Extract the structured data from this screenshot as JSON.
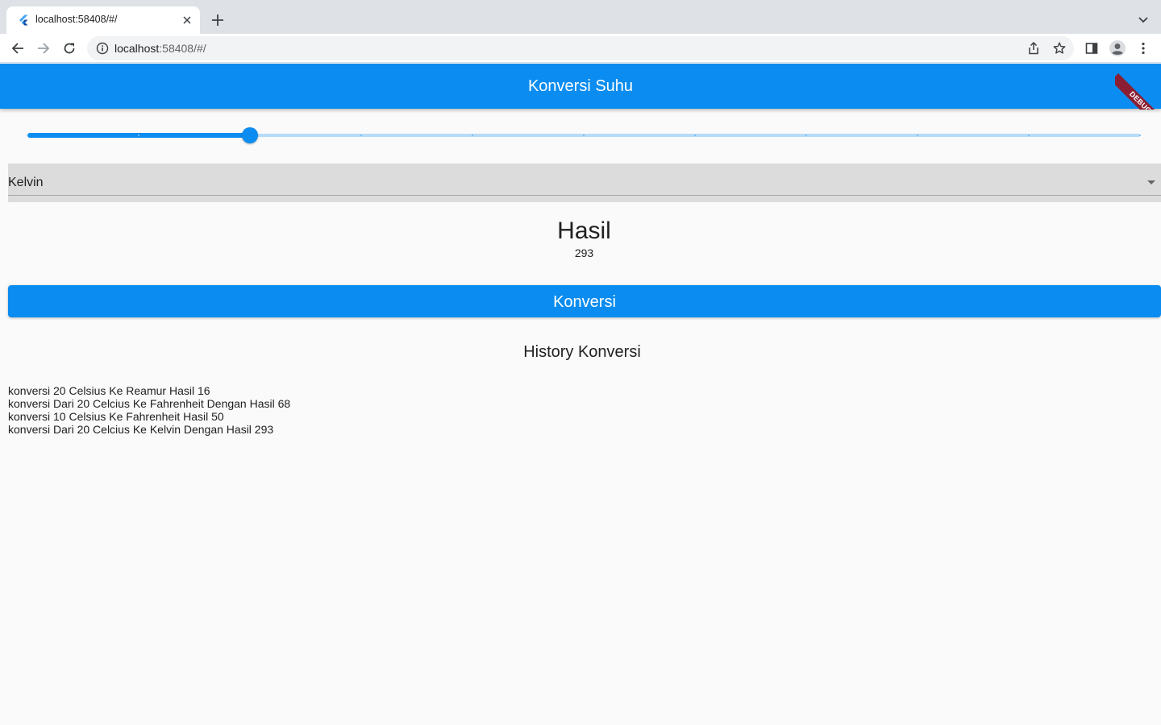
{
  "browser": {
    "tab_title": "localhost:58408/#/",
    "url_host": "localhost",
    "url_path": ":58408/#/"
  },
  "app": {
    "title": "Konversi Suhu",
    "debug_label": "DEBUG",
    "accent_color": "#0a8cf0"
  },
  "slider": {
    "value": 20,
    "min": 0,
    "max": 100,
    "divisions": 10
  },
  "dropdown": {
    "selected": "Kelvin"
  },
  "result": {
    "heading": "Hasil",
    "value": "293"
  },
  "convert_button": {
    "label": "Konversi"
  },
  "history": {
    "title": "History Konversi",
    "items": [
      "konversi 20 Celsius Ke Reamur Hasil 16",
      "konversi Dari 20 Celcius Ke Fahrenheit Dengan Hasil 68",
      "konversi 10 Celsius Ke Fahrenheit Hasil 50",
      "konversi Dari 20 Celcius Ke Kelvin Dengan Hasil 293"
    ]
  }
}
